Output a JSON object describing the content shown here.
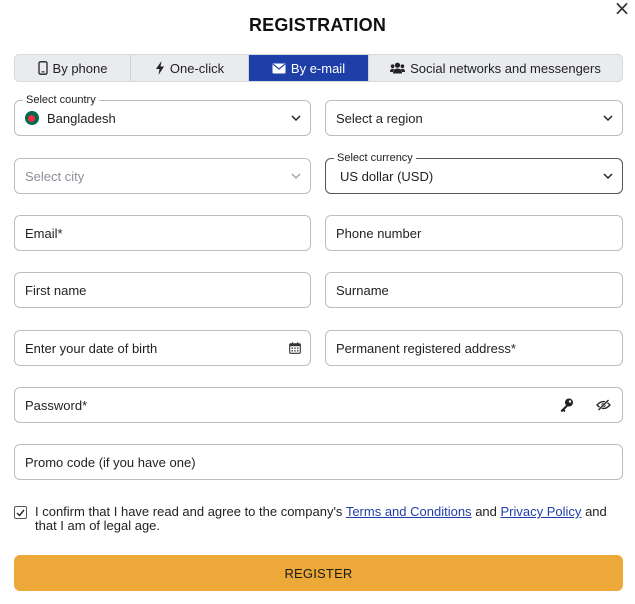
{
  "header": {
    "title": "REGISTRATION",
    "close_icon": "close-icon"
  },
  "tabs": [
    {
      "label": "By phone",
      "icon": "phone-icon",
      "active": false
    },
    {
      "label": "One-click",
      "icon": "lightning-icon",
      "active": false
    },
    {
      "label": "By e-mail",
      "icon": "envelope-icon",
      "active": true
    },
    {
      "label": "Social networks and messengers",
      "icon": "users-icon",
      "active": false
    }
  ],
  "form": {
    "country": {
      "label": "Select country",
      "value": "Bangladesh"
    },
    "region": {
      "placeholder": "Select a region"
    },
    "city": {
      "placeholder": "Select city"
    },
    "currency": {
      "label": "Select currency",
      "value": "US dollar (USD)"
    },
    "email": {
      "placeholder": "Email*"
    },
    "phone": {
      "placeholder": "Phone number"
    },
    "first_name": {
      "placeholder": "First name"
    },
    "surname": {
      "placeholder": "Surname"
    },
    "dob": {
      "placeholder": "Enter your date of birth"
    },
    "address": {
      "placeholder": "Permanent registered address*"
    },
    "password": {
      "placeholder": "Password*"
    },
    "promo": {
      "placeholder": "Promo code (if you have one)"
    }
  },
  "consent": {
    "checked": true,
    "text_1": "I confirm that I have read and agree to the company's",
    "terms_link": "Terms and Conditions",
    "text_2": "and",
    "privacy_link": "Privacy Policy",
    "text_3": "and that I am of legal age."
  },
  "submit": {
    "label": "REGISTER"
  },
  "colors": {
    "accent": "#1f3fa8",
    "button": "#eca93a",
    "border": "#b9bec6"
  }
}
